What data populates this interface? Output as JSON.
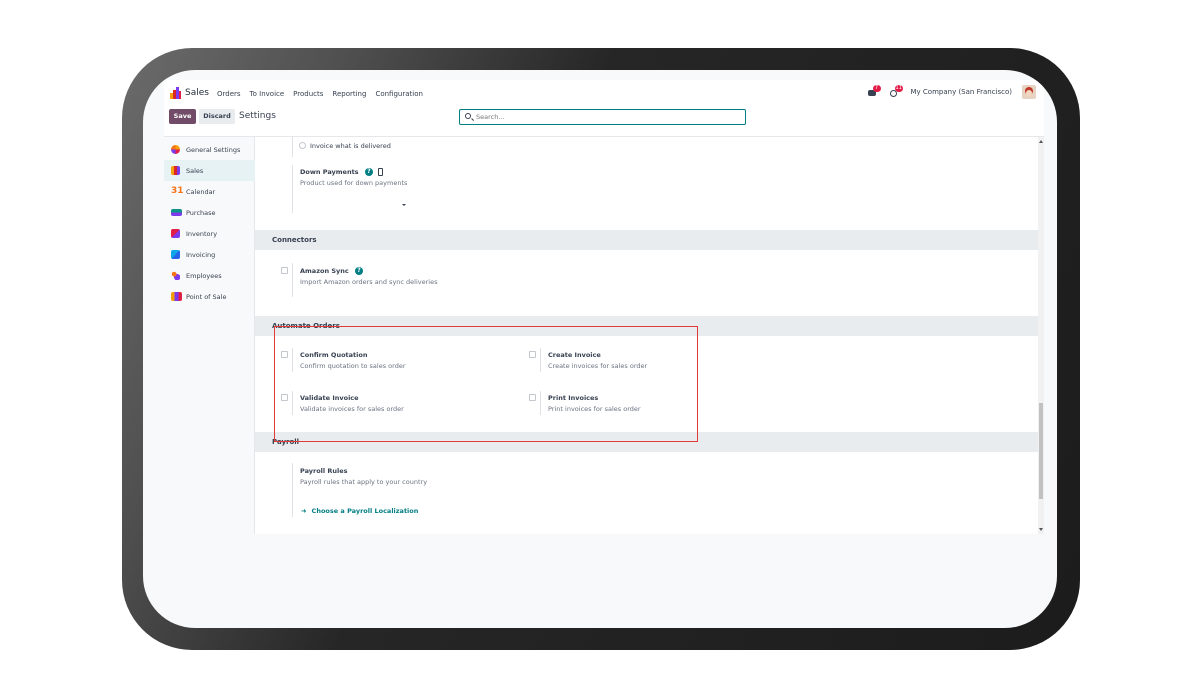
{
  "nav": {
    "brand": "Sales",
    "menu": [
      "Orders",
      "To Invoice",
      "Products",
      "Reporting",
      "Configuration"
    ],
    "chat_badge": "7",
    "activity_badge": "11",
    "company": "My Company (San Francisco)"
  },
  "control": {
    "save_label": "Save",
    "discard_label": "Discard",
    "title": "Settings",
    "search_placeholder": "Search..."
  },
  "sidebar": {
    "items": [
      {
        "label": "General Settings",
        "icon": "general-settings-icon"
      },
      {
        "label": "Sales",
        "icon": "sales-icon"
      },
      {
        "label": "Calendar",
        "icon": "calendar-icon"
      },
      {
        "label": "Purchase",
        "icon": "purchase-icon"
      },
      {
        "label": "Inventory",
        "icon": "inventory-icon"
      },
      {
        "label": "Invoicing",
        "icon": "invoicing-icon"
      },
      {
        "label": "Employees",
        "icon": "employees-icon"
      },
      {
        "label": "Point of Sale",
        "icon": "point-of-sale-icon"
      }
    ]
  },
  "content": {
    "invoice_option": "Invoice what is delivered",
    "down_payments": {
      "title": "Down Payments",
      "desc": "Product used for down payments"
    },
    "connectors": {
      "heading": "Connectors",
      "amazon": {
        "title": "Amazon Sync",
        "desc": "Import Amazon orders and sync deliveries"
      }
    },
    "automate": {
      "heading": "Automate Orders",
      "confirm": {
        "title": "Confirm Quotation",
        "desc": "Confirm quotation to sales order"
      },
      "create": {
        "title": "Create Invoice",
        "desc": "Create invoices for sales order"
      },
      "validate": {
        "title": "Validate Invoice",
        "desc": "Validate invoices for sales order"
      },
      "print": {
        "title": "Print Invoices",
        "desc": "Print invoices for sales order"
      }
    },
    "payroll": {
      "heading": "Payroll",
      "rules": {
        "title": "Payroll Rules",
        "desc": "Payroll rules that apply to your country"
      },
      "link": "Choose a Payroll Localization"
    }
  },
  "colors": {
    "brand_purple": "#714b67",
    "accent_teal": "#017e84",
    "highlight_red": "#e53935"
  }
}
